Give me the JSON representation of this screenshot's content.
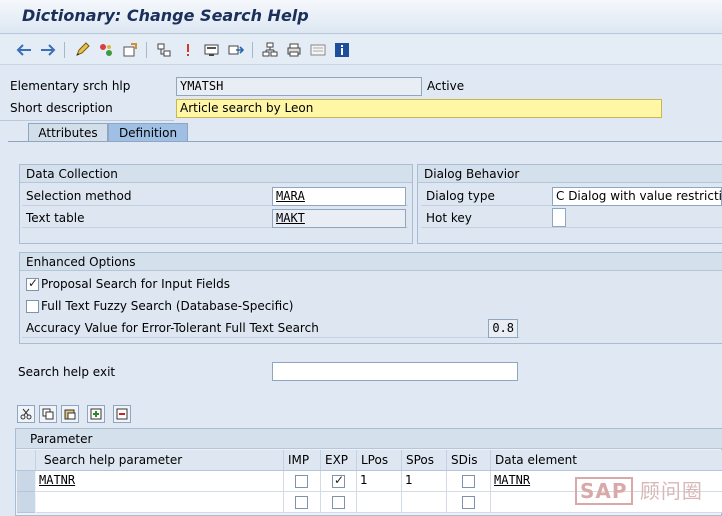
{
  "title": "Dictionary: Change Search Help",
  "toolbar": {
    "icons": [
      "back-arrow-icon",
      "forward-arrow-icon",
      "edit-pencil-icon",
      "toggle-active-icon",
      "other-object-icon",
      "check-icon",
      "activate-icon",
      "where-used-icon",
      "display-object-list-icon",
      "test-icon",
      "hierarchy-icon",
      "print-icon",
      "documentation-icon",
      "information-icon"
    ]
  },
  "header": {
    "elementary_label": "Elementary srch hlp",
    "elementary_value": "YMATSH",
    "status": "Active",
    "short_desc_label": "Short description",
    "short_desc_value": "Article search by Leon"
  },
  "tabs": [
    {
      "label": "Attributes"
    },
    {
      "label": "Definition"
    }
  ],
  "data_collection": {
    "title": "Data Collection",
    "selection_method_label": "Selection method",
    "selection_method_value": "MARA",
    "text_table_label": "Text table",
    "text_table_value": "MAKT"
  },
  "dialog_behavior": {
    "title": "Dialog Behavior",
    "dialog_type_label": "Dialog type",
    "dialog_type_value": "C Dialog with value restriction",
    "hot_key_label": "Hot key",
    "hot_key_value": ""
  },
  "enhanced_options": {
    "title": "Enhanced Options",
    "proposal_label": "Proposal Search for Input Fields",
    "proposal_checked": true,
    "fuzzy_label": "Full Text Fuzzy Search (Database-Specific)",
    "fuzzy_checked": false,
    "accuracy_label": "Accuracy Value for Error-Tolerant Full Text Search",
    "accuracy_value": "0.8"
  },
  "search_help_exit": {
    "label": "Search help exit",
    "value": ""
  },
  "table_controls": {
    "icons": [
      "cut-icon",
      "copy-icon",
      "paste-icon",
      "insert-row-icon",
      "delete-row-icon"
    ]
  },
  "parameter_table": {
    "title": "Parameter",
    "columns": [
      "Search help parameter",
      "IMP",
      "EXP",
      "LPos",
      "SPos",
      "SDis",
      "Data element"
    ],
    "rows": [
      {
        "param": "MATNR",
        "imp": false,
        "exp": true,
        "lpos": "1",
        "spos": "1",
        "sdis": false,
        "data_element": "MATNR"
      },
      {
        "param": "",
        "imp": false,
        "exp": false,
        "lpos": "",
        "spos": "",
        "sdis": false,
        "data_element": ""
      }
    ]
  },
  "watermark": {
    "brand": "SAP",
    "text": "顾问圈"
  }
}
